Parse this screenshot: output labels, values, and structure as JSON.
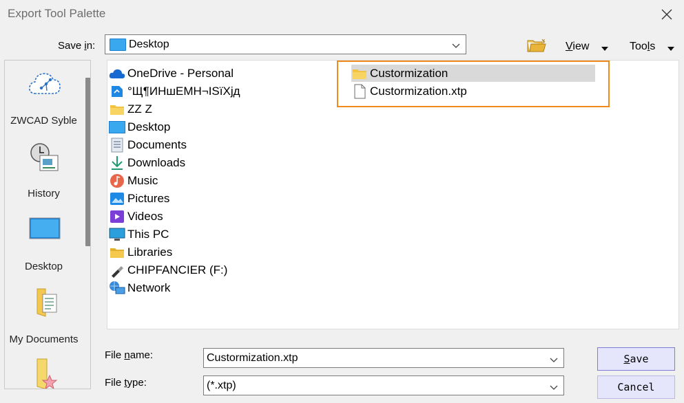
{
  "window": {
    "title": "Export Tool Palette"
  },
  "save_in": {
    "label_pre": "Save ",
    "label_key": "i",
    "label_post": "n:",
    "value": "Desktop"
  },
  "toolbar": {
    "view_key": "V",
    "view_rest": "iew",
    "tools_pre": "Too",
    "tools_key": "l",
    "tools_post": "s"
  },
  "places": [
    {
      "label": "ZWCAD Syble",
      "icon": "cloud-share-icon"
    },
    {
      "label": "History",
      "icon": "history-clock-icon"
    },
    {
      "label": "Desktop",
      "icon": "desktop-icon"
    },
    {
      "label": "My Documents",
      "icon": "my-documents-icon"
    },
    {
      "label": "",
      "icon": "favorites-icon"
    }
  ],
  "left_column": [
    {
      "label": "OneDrive - Personal",
      "icon": "onedrive-icon"
    },
    {
      "label": "°Щ¶ИНшЕМН¬ISïXjд",
      "icon": "app-icon"
    },
    {
      "label": "ZZ Z",
      "icon": "folder-icon"
    },
    {
      "label": "Desktop",
      "icon": "desktop-icon"
    },
    {
      "label": "Documents",
      "icon": "documents-icon"
    },
    {
      "label": "Downloads",
      "icon": "download-icon"
    },
    {
      "label": "Music",
      "icon": "music-icon"
    },
    {
      "label": "Pictures",
      "icon": "pictures-icon"
    },
    {
      "label": "Videos",
      "icon": "videos-icon"
    },
    {
      "label": "This PC",
      "icon": "computer-icon"
    },
    {
      "label": "Libraries",
      "icon": "libraries-icon"
    },
    {
      "label": "CHIPFANCIER (F:)",
      "icon": "usb-drive-icon"
    },
    {
      "label": "Network",
      "icon": "network-icon"
    }
  ],
  "right_column": [
    {
      "label": "Custormization",
      "icon": "folder-icon",
      "selected": true
    },
    {
      "label": "Custormization.xtp",
      "icon": "file-icon",
      "selected": false
    }
  ],
  "file_name": {
    "label_pre": "File ",
    "label_key": "n",
    "label_post": "ame:",
    "value": "Custormization.xtp"
  },
  "file_type": {
    "label_pre": "File ",
    "label_key": "t",
    "label_post": "ype:",
    "value": "(*.xtp)"
  },
  "buttons": {
    "save_key": "S",
    "save_rest": "ave",
    "cancel": "Cancel"
  },
  "colors": {
    "highlight": "#f08a1c",
    "selection": "#d9d9d9",
    "button_bg": "#e5e5fb"
  }
}
